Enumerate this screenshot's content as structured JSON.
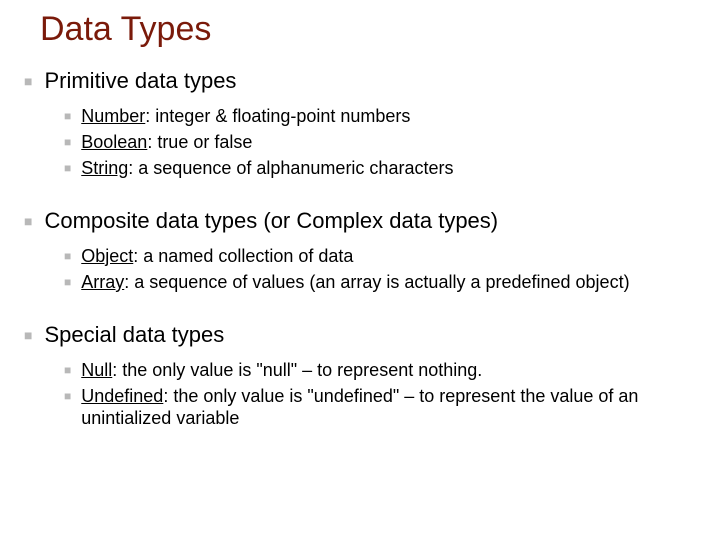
{
  "title": "Data Types",
  "sections": [
    {
      "heading": "Primitive data types",
      "items": [
        {
          "term": "Number",
          "desc": ": integer & floating-point numbers"
        },
        {
          "term": "Boolean",
          "desc": ": true or false"
        },
        {
          "term": "String",
          "desc": ": a sequence of alphanumeric characters"
        }
      ]
    },
    {
      "heading": "Composite data types (or Complex data types)",
      "items": [
        {
          "term": "Object",
          "desc": ": a named collection of data"
        },
        {
          "term": "Array",
          "desc": ": a sequence of values (an array is actually a predefined object)"
        }
      ]
    },
    {
      "heading": "Special data types",
      "items": [
        {
          "term": "Null",
          "desc": ": the only value is \"null\" – to represent nothing."
        },
        {
          "term": "Undefined",
          "desc": ": the only value is \"undefined\" – to represent the value of an unintialized variable"
        }
      ]
    }
  ]
}
